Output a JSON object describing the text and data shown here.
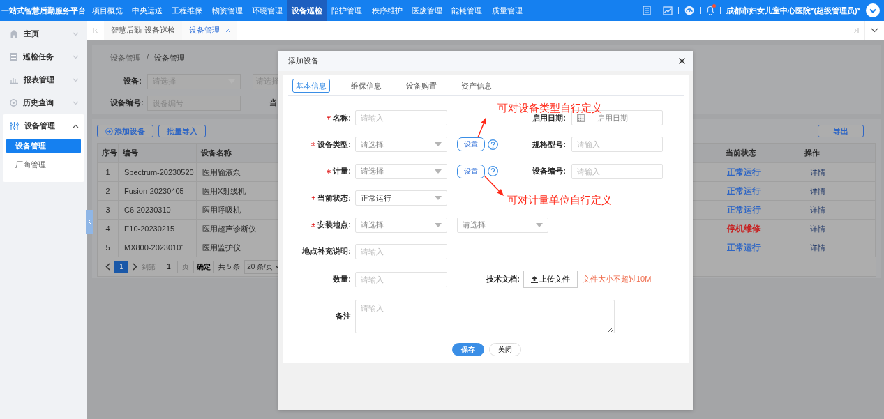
{
  "top_bar": {
    "title": "一站式智慧后勤服务平台",
    "user": "成都市妇女儿童中心医院*(超级管理员)*",
    "unread": true,
    "nav": [
      {
        "label": "项目概览",
        "selected": false
      },
      {
        "label": "中央运送",
        "selected": false
      },
      {
        "label": "工程维保",
        "selected": false
      },
      {
        "label": "物资管理",
        "selected": false
      },
      {
        "label": "环境管理",
        "selected": false
      },
      {
        "label": "设备巡检",
        "selected": true
      },
      {
        "label": "陪护管理",
        "selected": false
      },
      {
        "label": "秩序维护",
        "selected": false
      },
      {
        "label": "医废管理",
        "selected": false
      },
      {
        "label": "能耗管理",
        "selected": false
      },
      {
        "label": "质量管理",
        "selected": false
      }
    ]
  },
  "sidebar": {
    "items": [
      {
        "label": "主页",
        "expanded": false
      },
      {
        "label": "巡检任务",
        "expanded": false
      },
      {
        "label": "报表管理",
        "expanded": false
      },
      {
        "label": "历史查询",
        "expanded": false
      },
      {
        "label": "设备管理",
        "expanded": true,
        "children": [
          {
            "label": "设备管理",
            "selected": true
          },
          {
            "label": "厂商管理",
            "selected": false
          }
        ]
      }
    ]
  },
  "page_tabs": [
    {
      "label": "智慧后勤-设备巡检",
      "selected": false,
      "closable": false
    },
    {
      "label": "设备管理",
      "selected": true,
      "closable": true
    }
  ],
  "breadcrumb": {
    "items": [
      "设备管理",
      "设备管理"
    ],
    "separator": "/"
  },
  "filters": [
    [
      {
        "label": "设备:",
        "kind": "select",
        "placeholder": "请选择"
      },
      {
        "kind": "select",
        "placeholder": "请选择"
      }
    ],
    [
      {
        "label": "设备编号:",
        "kind": "input",
        "placeholder": "设备编号"
      },
      {
        "label": "当"
      }
    ]
  ],
  "table": {
    "toolbar": [
      {
        "label": "添加设备",
        "kind": "add"
      },
      {
        "label": "批量导入",
        "kind": "plain"
      }
    ],
    "export": "导出",
    "columns": [
      "序号",
      "编号",
      "设备名称",
      "当前状态",
      "操作"
    ],
    "rows": [
      {
        "index": "1",
        "code": "Spectrum-20230520",
        "name": "医用输液泵",
        "status": "正常运行",
        "color": "#2f66c4",
        "action": "详情"
      },
      {
        "index": "2",
        "code": "Fusion-20230405",
        "name": "医用X射线机",
        "status": "正常运行",
        "color": "#2f66c4",
        "action": "详情"
      },
      {
        "index": "3",
        "code": "C6-20230310",
        "name": "医用呼吸机",
        "status": "正常运行",
        "color": "#2f66c4",
        "action": "详情"
      },
      {
        "index": "4",
        "code": "E10-20230215",
        "name": "医用超声诊断仪",
        "status": "停机维修",
        "color": "#c81e1e",
        "action": "详情"
      },
      {
        "index": "5",
        "code": "MX800-20230101",
        "name": "医用监护仪",
        "status": "正常运行",
        "color": "#2f66c4",
        "action": "详情"
      }
    ],
    "pagination": {
      "pages": [
        {
          "label": "1",
          "selected": true
        }
      ],
      "goto_label": "到第",
      "goto_value": "1",
      "page_suffix": "页",
      "confirm": "确定",
      "total": "共 5 条",
      "page_size": "20 条/页"
    }
  },
  "modal": {
    "title": "添加设备",
    "tabs": [
      {
        "label": "基本信息",
        "selected": true
      },
      {
        "label": "维保信息",
        "selected": false
      },
      {
        "label": "设备购置",
        "selected": false
      },
      {
        "label": "资产信息",
        "selected": false
      }
    ],
    "rows": [
      {
        "left": {
          "label": "名称:",
          "required": true,
          "kind": "input",
          "placeholder": "请输入"
        },
        "right": {
          "label": "启用日期:",
          "kind": "date",
          "placeholder": "启用日期"
        }
      },
      {
        "left": {
          "label": "设备类型:",
          "required": true,
          "kind": "select",
          "placeholder": "请选择"
        },
        "extra": {
          "kind": "setting",
          "label": "设置"
        },
        "right": {
          "label": "规格型号:",
          "kind": "input",
          "placeholder": "请输入"
        }
      },
      {
        "left": {
          "label": "计量:",
          "required": true,
          "kind": "select",
          "placeholder": "请选择"
        },
        "extra": {
          "kind": "setting",
          "label": "设置"
        },
        "right": {
          "label": "设备编号:",
          "kind": "input",
          "placeholder": "请输入"
        }
      },
      {
        "left": {
          "label": "当前状态:",
          "required": true,
          "kind": "select",
          "value": "正常运行"
        }
      },
      {
        "left": {
          "label": "安装地点:",
          "required": true,
          "kind": "select",
          "placeholder": "请选择"
        },
        "extra": {
          "kind": "select",
          "placeholder": "请选择"
        }
      },
      {
        "left": {
          "label": "地点补充说明:",
          "required": false,
          "kind": "input",
          "placeholder": "请输入"
        }
      },
      {
        "left": {
          "label": "数量:",
          "required": false,
          "kind": "input",
          "placeholder": "请输入"
        },
        "right": {
          "label": "技术文档:",
          "kind": "upload",
          "button": "上传文件",
          "note": "文件大小不超过10M"
        }
      },
      {
        "left": {
          "label": "备注",
          "required": false,
          "kind": "textarea",
          "placeholder": "请输入"
        }
      }
    ],
    "buttons": [
      {
        "label": "保存",
        "kind": "primary"
      },
      {
        "label": "关闭",
        "kind": "default"
      }
    ],
    "annotations": [
      {
        "text": "可对设备类型自行定义"
      },
      {
        "text": "可对计量单位自行定义"
      }
    ]
  }
}
